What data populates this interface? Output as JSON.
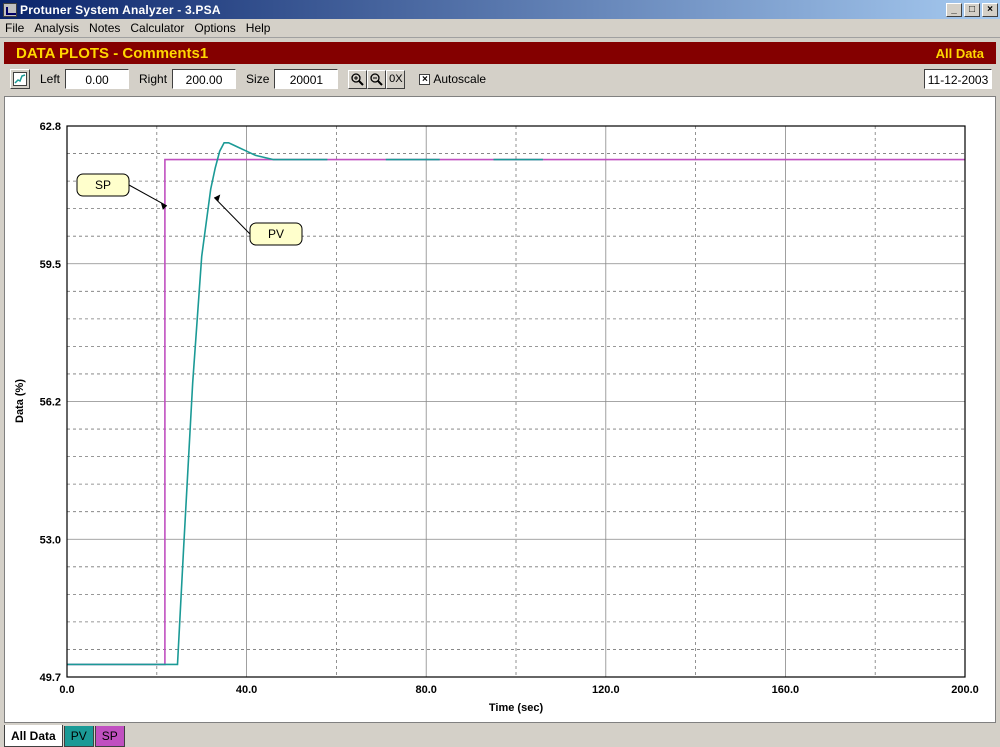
{
  "window": {
    "title": "Protuner System Analyzer - 3.PSA"
  },
  "menu": [
    "File",
    "Analysis",
    "Notes",
    "Calculator",
    "Options",
    "Help"
  ],
  "header": {
    "title": "DATA PLOTS - Comments1",
    "right_label": "All Data"
  },
  "toolbar": {
    "left_label": "Left",
    "left_value": "0.00",
    "right_label": "Right",
    "right_value": "200.00",
    "size_label": "Size",
    "size_value": "20001",
    "zoom_in_icon": "zoom-in-icon",
    "zoom_out_icon": "zoom-out-icon",
    "zoom_reset_label": "0X",
    "autoscale_checked": true,
    "autoscale_label": "Autoscale",
    "date": "11-12-2003"
  },
  "chart_data": {
    "type": "line",
    "xlabel": "Time (sec)",
    "ylabel": "Data (%)",
    "xlim": [
      0,
      200
    ],
    "ylim": [
      49.7,
      62.8
    ],
    "x_ticks": [
      "0.0",
      "40.0",
      "80.0",
      "120.0",
      "160.0",
      "200.0"
    ],
    "y_ticks": [
      "49.7",
      "53.0",
      "56.2",
      "59.5",
      "62.8"
    ],
    "grid": true,
    "series": [
      {
        "name": "SP",
        "color": "#c050c0",
        "x": [
          0,
          21.8,
          21.8,
          200
        ],
        "y": [
          50.0,
          50.0,
          62.0,
          62.0
        ]
      },
      {
        "name": "PV",
        "color": "#1b9a96",
        "x": [
          0,
          24.6,
          26,
          28,
          30,
          32,
          33,
          34,
          35,
          36,
          37,
          38,
          40,
          42,
          44,
          46,
          50,
          58
        ],
        "y": [
          50.0,
          50.0,
          52.8,
          56.7,
          59.7,
          61.3,
          61.8,
          62.2,
          62.4,
          62.4,
          62.35,
          62.3,
          62.2,
          62.1,
          62.05,
          62.0,
          62.0,
          62.0
        ]
      },
      {
        "name": "PV",
        "color": "#1b9a96",
        "x": [
          71,
          83
        ],
        "y": [
          62.0,
          62.0
        ]
      },
      {
        "name": "PV",
        "color": "#1b9a96",
        "x": [
          95,
          106
        ],
        "y": [
          62.0,
          62.0
        ]
      }
    ],
    "annotations": [
      {
        "label": "SP",
        "target_x": 21.8,
        "target_y": 60.9
      },
      {
        "label": "PV",
        "target_x": 32.8,
        "target_y": 61.1
      }
    ]
  },
  "tabs": [
    "All Data",
    "PV",
    "SP"
  ]
}
